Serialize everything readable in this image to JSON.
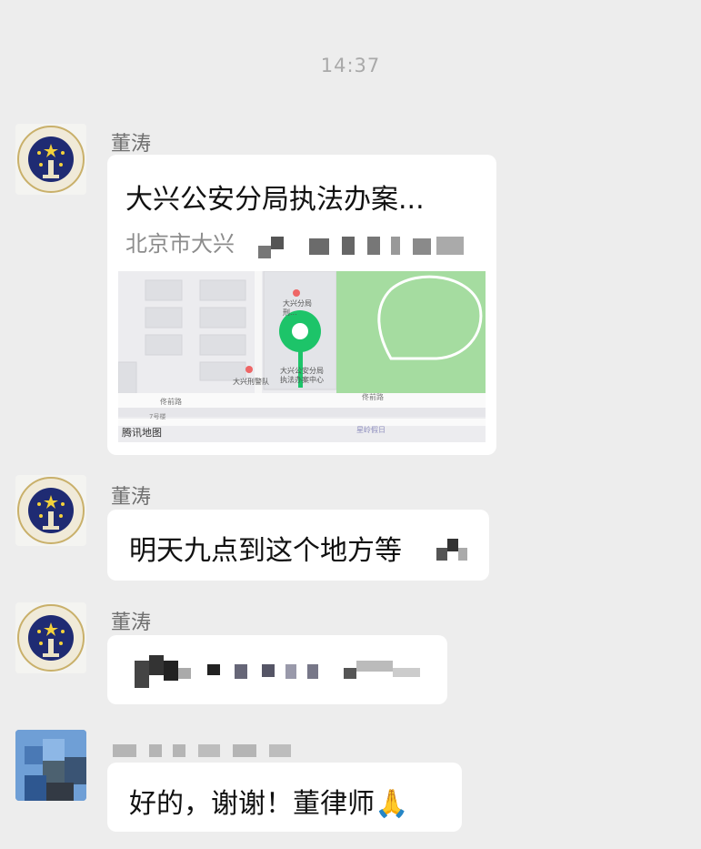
{
  "timestamp": "14:37",
  "messages": [
    {
      "sender": "董涛",
      "type": "location",
      "title": "大兴公安分局执法办案...",
      "address": "北京市大兴",
      "map": {
        "labels": {
          "poi_top": "大兴分局",
          "poi_top2": "刑...",
          "poi_center_1": "大兴公安分局",
          "poi_center_2": "执法办案中心",
          "poi_left": "大兴刑警队",
          "road_left": "佟前路",
          "road_right": "佟前路",
          "road_small": "7号楼",
          "road_bottom": "星岭假日"
        },
        "brand": "腾讯地图",
        "pin_color": "#1dc469",
        "park_color": "#a5dca0"
      }
    },
    {
      "sender": "董涛",
      "type": "text",
      "text": "明天九点到这个地方等"
    },
    {
      "sender": "董涛",
      "type": "text",
      "text": ""
    },
    {
      "sender": "",
      "type": "text",
      "text": "好的，谢谢！董律师🙏"
    }
  ]
}
